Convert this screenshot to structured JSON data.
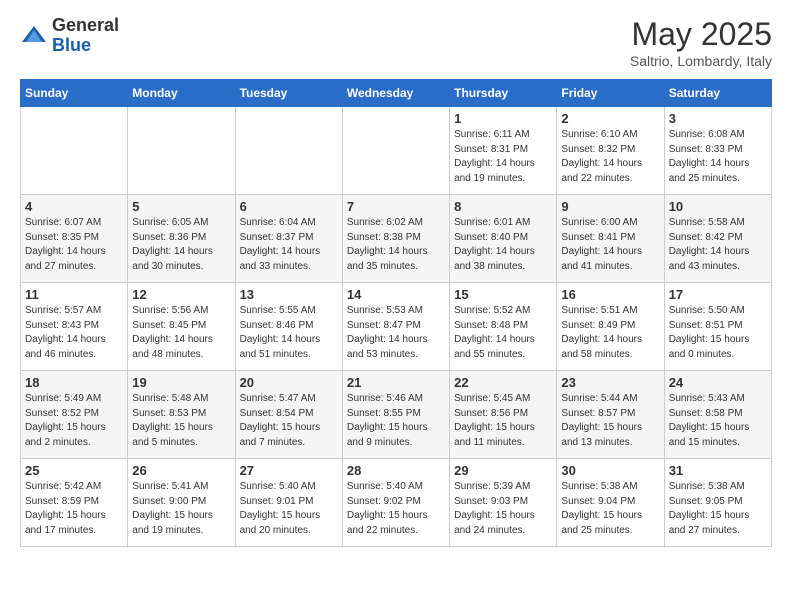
{
  "header": {
    "logo_general": "General",
    "logo_blue": "Blue",
    "title": "May 2025",
    "subtitle": "Saltrio, Lombardy, Italy"
  },
  "days_of_week": [
    "Sunday",
    "Monday",
    "Tuesday",
    "Wednesday",
    "Thursday",
    "Friday",
    "Saturday"
  ],
  "weeks": [
    [
      {
        "day": "",
        "info": ""
      },
      {
        "day": "",
        "info": ""
      },
      {
        "day": "",
        "info": ""
      },
      {
        "day": "",
        "info": ""
      },
      {
        "day": "1",
        "info": "Sunrise: 6:11 AM\nSunset: 8:31 PM\nDaylight: 14 hours\nand 19 minutes."
      },
      {
        "day": "2",
        "info": "Sunrise: 6:10 AM\nSunset: 8:32 PM\nDaylight: 14 hours\nand 22 minutes."
      },
      {
        "day": "3",
        "info": "Sunrise: 6:08 AM\nSunset: 8:33 PM\nDaylight: 14 hours\nand 25 minutes."
      }
    ],
    [
      {
        "day": "4",
        "info": "Sunrise: 6:07 AM\nSunset: 8:35 PM\nDaylight: 14 hours\nand 27 minutes."
      },
      {
        "day": "5",
        "info": "Sunrise: 6:05 AM\nSunset: 8:36 PM\nDaylight: 14 hours\nand 30 minutes."
      },
      {
        "day": "6",
        "info": "Sunrise: 6:04 AM\nSunset: 8:37 PM\nDaylight: 14 hours\nand 33 minutes."
      },
      {
        "day": "7",
        "info": "Sunrise: 6:02 AM\nSunset: 8:38 PM\nDaylight: 14 hours\nand 35 minutes."
      },
      {
        "day": "8",
        "info": "Sunrise: 6:01 AM\nSunset: 8:40 PM\nDaylight: 14 hours\nand 38 minutes."
      },
      {
        "day": "9",
        "info": "Sunrise: 6:00 AM\nSunset: 8:41 PM\nDaylight: 14 hours\nand 41 minutes."
      },
      {
        "day": "10",
        "info": "Sunrise: 5:58 AM\nSunset: 8:42 PM\nDaylight: 14 hours\nand 43 minutes."
      }
    ],
    [
      {
        "day": "11",
        "info": "Sunrise: 5:57 AM\nSunset: 8:43 PM\nDaylight: 14 hours\nand 46 minutes."
      },
      {
        "day": "12",
        "info": "Sunrise: 5:56 AM\nSunset: 8:45 PM\nDaylight: 14 hours\nand 48 minutes."
      },
      {
        "day": "13",
        "info": "Sunrise: 5:55 AM\nSunset: 8:46 PM\nDaylight: 14 hours\nand 51 minutes."
      },
      {
        "day": "14",
        "info": "Sunrise: 5:53 AM\nSunset: 8:47 PM\nDaylight: 14 hours\nand 53 minutes."
      },
      {
        "day": "15",
        "info": "Sunrise: 5:52 AM\nSunset: 8:48 PM\nDaylight: 14 hours\nand 55 minutes."
      },
      {
        "day": "16",
        "info": "Sunrise: 5:51 AM\nSunset: 8:49 PM\nDaylight: 14 hours\nand 58 minutes."
      },
      {
        "day": "17",
        "info": "Sunrise: 5:50 AM\nSunset: 8:51 PM\nDaylight: 15 hours\nand 0 minutes."
      }
    ],
    [
      {
        "day": "18",
        "info": "Sunrise: 5:49 AM\nSunset: 8:52 PM\nDaylight: 15 hours\nand 2 minutes."
      },
      {
        "day": "19",
        "info": "Sunrise: 5:48 AM\nSunset: 8:53 PM\nDaylight: 15 hours\nand 5 minutes."
      },
      {
        "day": "20",
        "info": "Sunrise: 5:47 AM\nSunset: 8:54 PM\nDaylight: 15 hours\nand 7 minutes."
      },
      {
        "day": "21",
        "info": "Sunrise: 5:46 AM\nSunset: 8:55 PM\nDaylight: 15 hours\nand 9 minutes."
      },
      {
        "day": "22",
        "info": "Sunrise: 5:45 AM\nSunset: 8:56 PM\nDaylight: 15 hours\nand 11 minutes."
      },
      {
        "day": "23",
        "info": "Sunrise: 5:44 AM\nSunset: 8:57 PM\nDaylight: 15 hours\nand 13 minutes."
      },
      {
        "day": "24",
        "info": "Sunrise: 5:43 AM\nSunset: 8:58 PM\nDaylight: 15 hours\nand 15 minutes."
      }
    ],
    [
      {
        "day": "25",
        "info": "Sunrise: 5:42 AM\nSunset: 8:59 PM\nDaylight: 15 hours\nand 17 minutes."
      },
      {
        "day": "26",
        "info": "Sunrise: 5:41 AM\nSunset: 9:00 PM\nDaylight: 15 hours\nand 19 minutes."
      },
      {
        "day": "27",
        "info": "Sunrise: 5:40 AM\nSunset: 9:01 PM\nDaylight: 15 hours\nand 20 minutes."
      },
      {
        "day": "28",
        "info": "Sunrise: 5:40 AM\nSunset: 9:02 PM\nDaylight: 15 hours\nand 22 minutes."
      },
      {
        "day": "29",
        "info": "Sunrise: 5:39 AM\nSunset: 9:03 PM\nDaylight: 15 hours\nand 24 minutes."
      },
      {
        "day": "30",
        "info": "Sunrise: 5:38 AM\nSunset: 9:04 PM\nDaylight: 15 hours\nand 25 minutes."
      },
      {
        "day": "31",
        "info": "Sunrise: 5:38 AM\nSunset: 9:05 PM\nDaylight: 15 hours\nand 27 minutes."
      }
    ]
  ]
}
